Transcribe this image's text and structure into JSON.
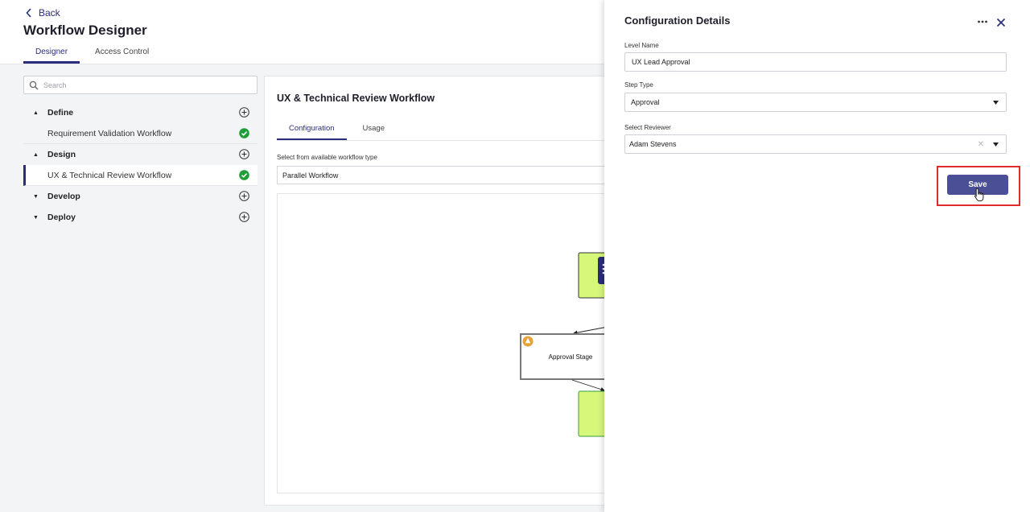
{
  "header": {
    "back_label": "Back",
    "title": "Workflow Designer",
    "tabs": [
      {
        "label": "Designer",
        "active": true
      },
      {
        "label": "Access Control",
        "active": false
      }
    ]
  },
  "sidebar": {
    "search_placeholder": "Search",
    "sections": [
      {
        "label": "Define",
        "expanded": true,
        "items": [
          {
            "label": "Requirement Validation Workflow",
            "complete": true
          }
        ]
      },
      {
        "label": "Design",
        "expanded": true,
        "items": [
          {
            "label": "UX & Technical Review Workflow",
            "complete": true,
            "selected": true
          }
        ]
      },
      {
        "label": "Develop",
        "expanded": false,
        "items": []
      },
      {
        "label": "Deploy",
        "expanded": false,
        "items": []
      }
    ]
  },
  "main": {
    "title": "UX & Technical Review Workflow",
    "tabs": [
      {
        "label": "Configuration",
        "active": true
      },
      {
        "label": "Usage",
        "active": false
      }
    ],
    "workflow_type_label": "Select from available workflow type",
    "workflow_type_value": "Parallel Workflow",
    "diagram": {
      "stage_label": "Approval Stage"
    }
  },
  "config_panel": {
    "title": "Configuration Details",
    "fields": {
      "level_name_label": "Level Name",
      "level_name_value": "UX Lead Approval",
      "step_type_label": "Step Type",
      "step_type_value": "Approval",
      "reviewer_label": "Select Reviewer",
      "reviewer_value": "Adam Stevens"
    },
    "save_label": "Save"
  },
  "colors": {
    "accent": "#2a2d7c",
    "save_button": "#4a4f96",
    "highlight_border": "#e12a2a",
    "success": "#1f9d3a",
    "node_fill": "#d6f77a",
    "warning": "#e8a23a"
  }
}
